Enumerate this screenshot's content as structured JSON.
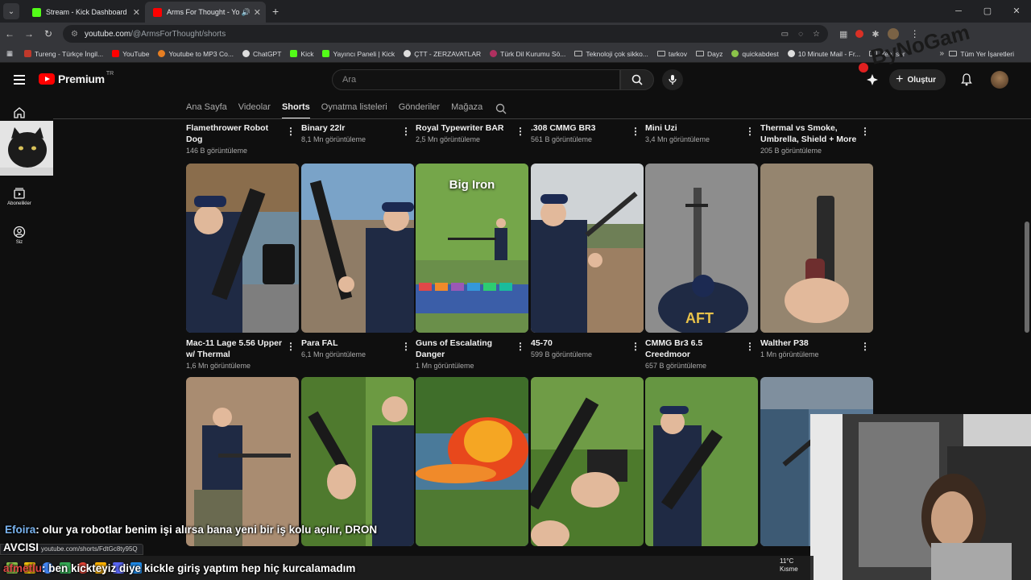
{
  "browser": {
    "tabs": [
      {
        "title": "Stream - Kick Dashboard",
        "color": "#53fc18"
      },
      {
        "title": "Arms For Thought - YouTub",
        "color": "#ff0000"
      }
    ],
    "url_host": "youtube.com",
    "url_path": "/@ArmsForThought/shorts",
    "status_url": "youtube.com/shorts/FdtGc8ty95Q"
  },
  "bookmarks": {
    "items": [
      "Tureng - Türkçe İngil...",
      "YouTube",
      "Youtube to MP3 Co...",
      "ChatGPT",
      "Kick",
      "Yayıncı Paneli | Kick",
      "ÇTT - ZERZAVATLAR",
      "Türk Dil Kurumu Sö...",
      "Teknoloji çok sikko...",
      "tarkov",
      "Dayz",
      "quickabdest",
      "10 Minute Mail - Fr...",
      "Yeni sor"
    ],
    "right_label": "Tüm Yer İşaretleri"
  },
  "youtube": {
    "logo_text": "Premium",
    "logo_country": "TR",
    "search_placeholder": "Ara",
    "create_label": "Oluştur",
    "rail": {
      "subscriptions": "Abonelikler",
      "you": "Siz"
    },
    "channel_tabs": [
      "Ana Sayfa",
      "Videolar",
      "Shorts",
      "Oynatma listeleri",
      "Gönderiler",
      "Mağaza"
    ],
    "active_tab": "Shorts"
  },
  "shorts_row0": [
    {
      "title": "Flamethrower Robot Dog",
      "views": "146 B görüntüleme"
    },
    {
      "title": "Binary 22lr",
      "views": "8,1 Mn görüntüleme"
    },
    {
      "title": "Royal Typewriter BAR",
      "views": "2,5 Mn görüntüleme"
    },
    {
      "title": ".308 CMMG BR3",
      "views": "561 B görüntüleme"
    },
    {
      "title": "Mini Uzi",
      "views": "3,4 Mn görüntüleme"
    },
    {
      "title": "Thermal vs Smoke, Umbrella, Shield + More",
      "views": "205 B görüntüleme"
    }
  ],
  "shorts_row1": [
    {
      "title": "Mac-11 Lage 5.56 Upper w/ Thermal",
      "views": "1,6 Mn görüntüleme",
      "overlay": ""
    },
    {
      "title": "Para FAL",
      "views": "6,1 Mn görüntüleme",
      "overlay": ""
    },
    {
      "title": "Guns of Escalating Danger",
      "views": "1 Mn görüntüleme",
      "overlay": "Big Iron"
    },
    {
      "title": "45-70",
      "views": "599 B görüntüleme",
      "overlay": ""
    },
    {
      "title": "CMMG Br3 6.5 Creedmoor",
      "views": "657 B görüntüleme",
      "overlay": ""
    },
    {
      "title": "Walther P38",
      "views": "1 Mn görüntüleme",
      "overlay": ""
    }
  ],
  "chat": {
    "line1_user": "Efoira",
    "line1_text": ": olur ya robotlar benim işi alırsa bana yeni bir iş kolu açılır, DRON",
    "line1_cont": "AVCISI",
    "line2_user": "afmetlu",
    "line2_text": ": ben kickteyiz diye kickle giriş yaptım hep hiç kurcalamadım"
  },
  "weather": {
    "temp": "11°C",
    "desc": "Kısme"
  },
  "watermark_text": "ByNoGam",
  "colors": {
    "bg": "#0f0f0f",
    "accent": "#ff0000",
    "kick": "#53fc18",
    "chat_user1": "#7ab4f0",
    "chat_user2": "#e04848"
  }
}
